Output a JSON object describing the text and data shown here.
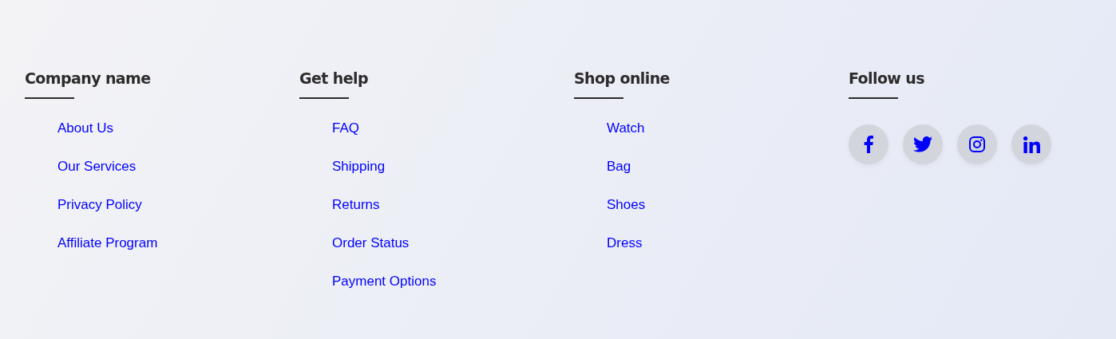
{
  "columns": [
    {
      "title": "Company name",
      "links": [
        "About Us",
        "Our Services",
        "Privacy Policy",
        "Affiliate Program"
      ]
    },
    {
      "title": "Get help",
      "links": [
        "FAQ",
        "Shipping",
        "Returns",
        "Order Status",
        "Payment Options"
      ]
    },
    {
      "title": "Shop online",
      "links": [
        "Watch",
        "Bag",
        "Shoes",
        "Dress"
      ]
    }
  ],
  "follow": {
    "title": "Follow us",
    "social": [
      {
        "kind": "facebook"
      },
      {
        "kind": "twitter"
      },
      {
        "kind": "instagram"
      },
      {
        "kind": "linkedin"
      }
    ]
  }
}
